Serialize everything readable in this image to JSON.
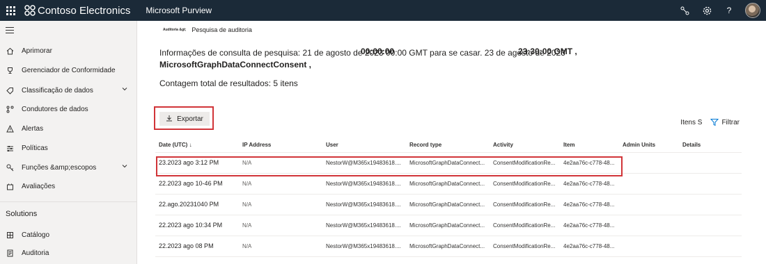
{
  "topbar": {
    "brand": "Contoso Electronics",
    "app_name": "Microsoft Purview",
    "icons": [
      "waffle-icon",
      "connections-icon",
      "gear-icon",
      "help-icon",
      "avatar"
    ],
    "help_glyph": "?"
  },
  "sidebar": {
    "items": [
      {
        "label": "Aprimorar",
        "icon": "home-icon"
      },
      {
        "label": "Gerenciador de Conformidade",
        "icon": "trophy-icon"
      },
      {
        "label": "Classificação de dados",
        "icon": "tag-icon"
      },
      {
        "label": "Condutores de dados",
        "icon": "connectors-icon"
      },
      {
        "label": "Alertas",
        "icon": "warning-icon"
      },
      {
        "label": "Políticas",
        "icon": "sliders-icon"
      },
      {
        "label": "Funções &amp;escopos",
        "icon": "key-icon"
      },
      {
        "label": "Avaliações",
        "icon": "assessment-icon"
      }
    ],
    "section_title": "Solutions",
    "solutions": [
      {
        "label": "Catálogo",
        "icon": "catalog-icon"
      },
      {
        "label": "Auditoria",
        "icon": "audit-icon"
      }
    ]
  },
  "main": {
    "breadcrumb_parent": "Auditoria &gt;",
    "breadcrumb_current": "Pesquisa de auditoria",
    "query_line1": "Informações de consulta de pesquisa: 21 de agosto de 2023 00:00 GMT para se casar. 23 de agosto de 2023",
    "query_overlay_time1": "00:00:00",
    "query_overlay_time2": "23:30:00 GMT ,",
    "query_line2": "MicrosoftGraphDataConnectConsent ,",
    "total_results": "Contagem total de resultados: 5 itens",
    "export_label": "Exportar",
    "items_label": "Itens S",
    "filter_label": "Filtrar",
    "sort_glyph": "↓"
  },
  "table": {
    "headers": [
      "Date (UTC)",
      "IP Address",
      "User",
      "Record type",
      "Activity",
      "Item",
      "Admin Units",
      "Details"
    ],
    "rows": [
      {
        "date": "23.2023 ago 3:12 PM",
        "ip": "N/A",
        "user": "NestorW@M365x19483618....",
        "record_type": "MicrosoftGraphDataConnect...",
        "activity": "ConsentModificationRe...",
        "item": "4e2aa76c-c778-48..."
      },
      {
        "date": "22.2023 ago 10-46 PM",
        "ip": "N/A",
        "user": "NestorW@M365x19483618....",
        "record_type": "MicrosoftGraphDataConnect...",
        "activity": "ConsentModificationRe...",
        "item": "4e2aa76c-c778-48..."
      },
      {
        "date": "22.ago.20231040 PM",
        "ip": "N/A",
        "user": "NestorW@M365x19483618....",
        "record_type": "MicrosoftGraphDataConnect...",
        "activity": "ConsentModificationRe...",
        "item": "4e2aa76c-c778-48..."
      },
      {
        "date": "22.2023 ago 10:34 PM",
        "ip": "N/A",
        "user": "NestorW@M365x19483618....",
        "record_type": "MicrosoftGraphDataConnect...",
        "activity": "ConsentModificationRe...",
        "item": "4e2aa76c-c778-48..."
      },
      {
        "date": "22.2023 ago 08 PM",
        "ip": "N/A",
        "user": "NestorW@M365x19483618....",
        "record_type": "MicrosoftGraphDataConnect...",
        "activity": "ConsentModificationRe...",
        "item": "4e2aa76c-c778-48..."
      }
    ]
  },
  "colors": {
    "topbar": "#1b2a38",
    "highlight": "#d13438",
    "sidebar": "#f3f2f1"
  }
}
